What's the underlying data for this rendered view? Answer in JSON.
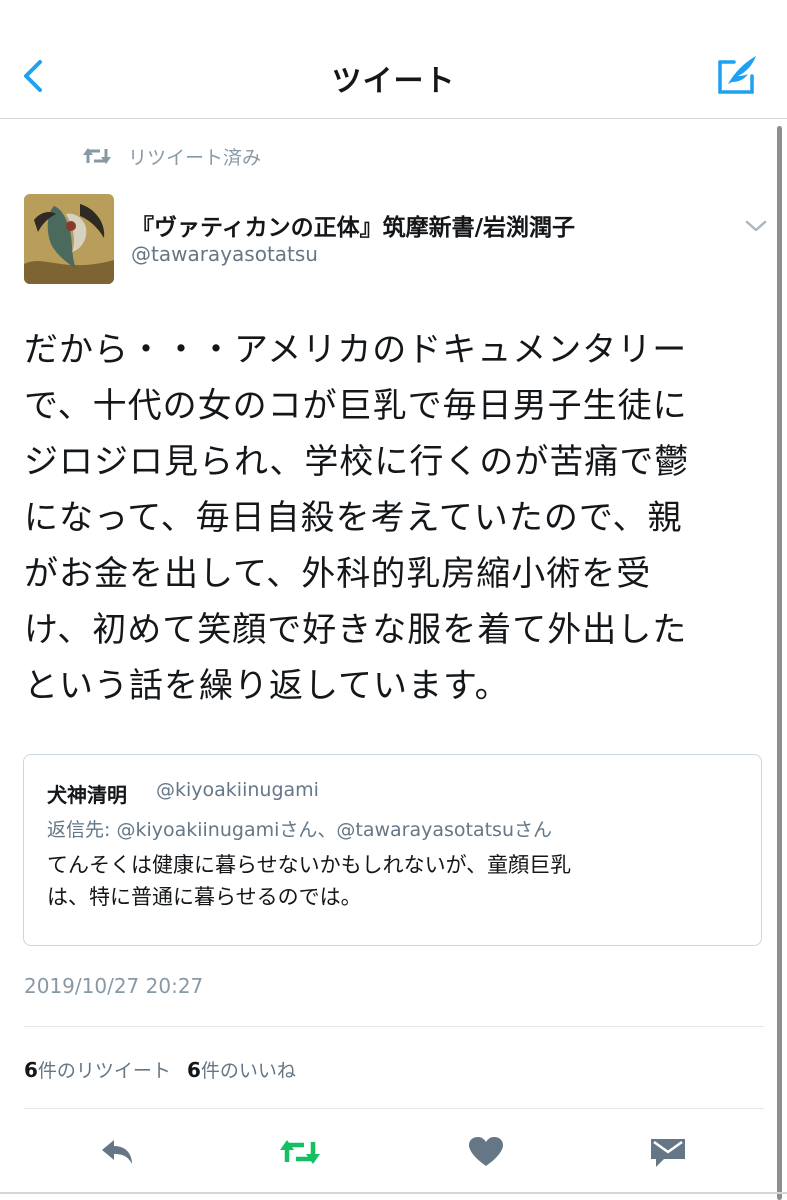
{
  "nav": {
    "title": "ツイート",
    "accent": "#1da1f2"
  },
  "retweet_context": {
    "label": "リツイート済み"
  },
  "author": {
    "name": "『ヴァティカンの正体』筑摩新書/岩渕潤子",
    "handle": "@tawarayasotatsu"
  },
  "tweet": {
    "lines": [
      "だから・・・アメリカのドキュメンタリー",
      "で、十代の女のコが巨乳で毎日男子生徒に",
      "ジロジロ見られ、学校に行くのが苦痛で鬱",
      "になって、毎日自殺を考えていたので、親",
      "がお金を出して、外科的乳房縮小術を受",
      "け、初めて笑顔で好きな服を着て外出した",
      "という話を繰り返しています。"
    ]
  },
  "quoted": {
    "name": "犬神清明",
    "handle": "@kiyoakiinugami",
    "reply_to": "返信先: @kiyoakiinugamiさん、@tawarayasotatsuさん",
    "lines": [
      "てんそくは健康に暮らせないかもしれないが、童顔巨乳",
      "は、特に普通に暮らせるのでは。"
    ]
  },
  "timestamp": "2019/10/27 20:27",
  "stats": {
    "retweets_count": "6",
    "retweets_label": "件のリツイート",
    "likes_count": "6",
    "likes_label": "件のいいね"
  },
  "colors": {
    "retweeted": "#17bf63",
    "icon_gray": "#657786"
  }
}
